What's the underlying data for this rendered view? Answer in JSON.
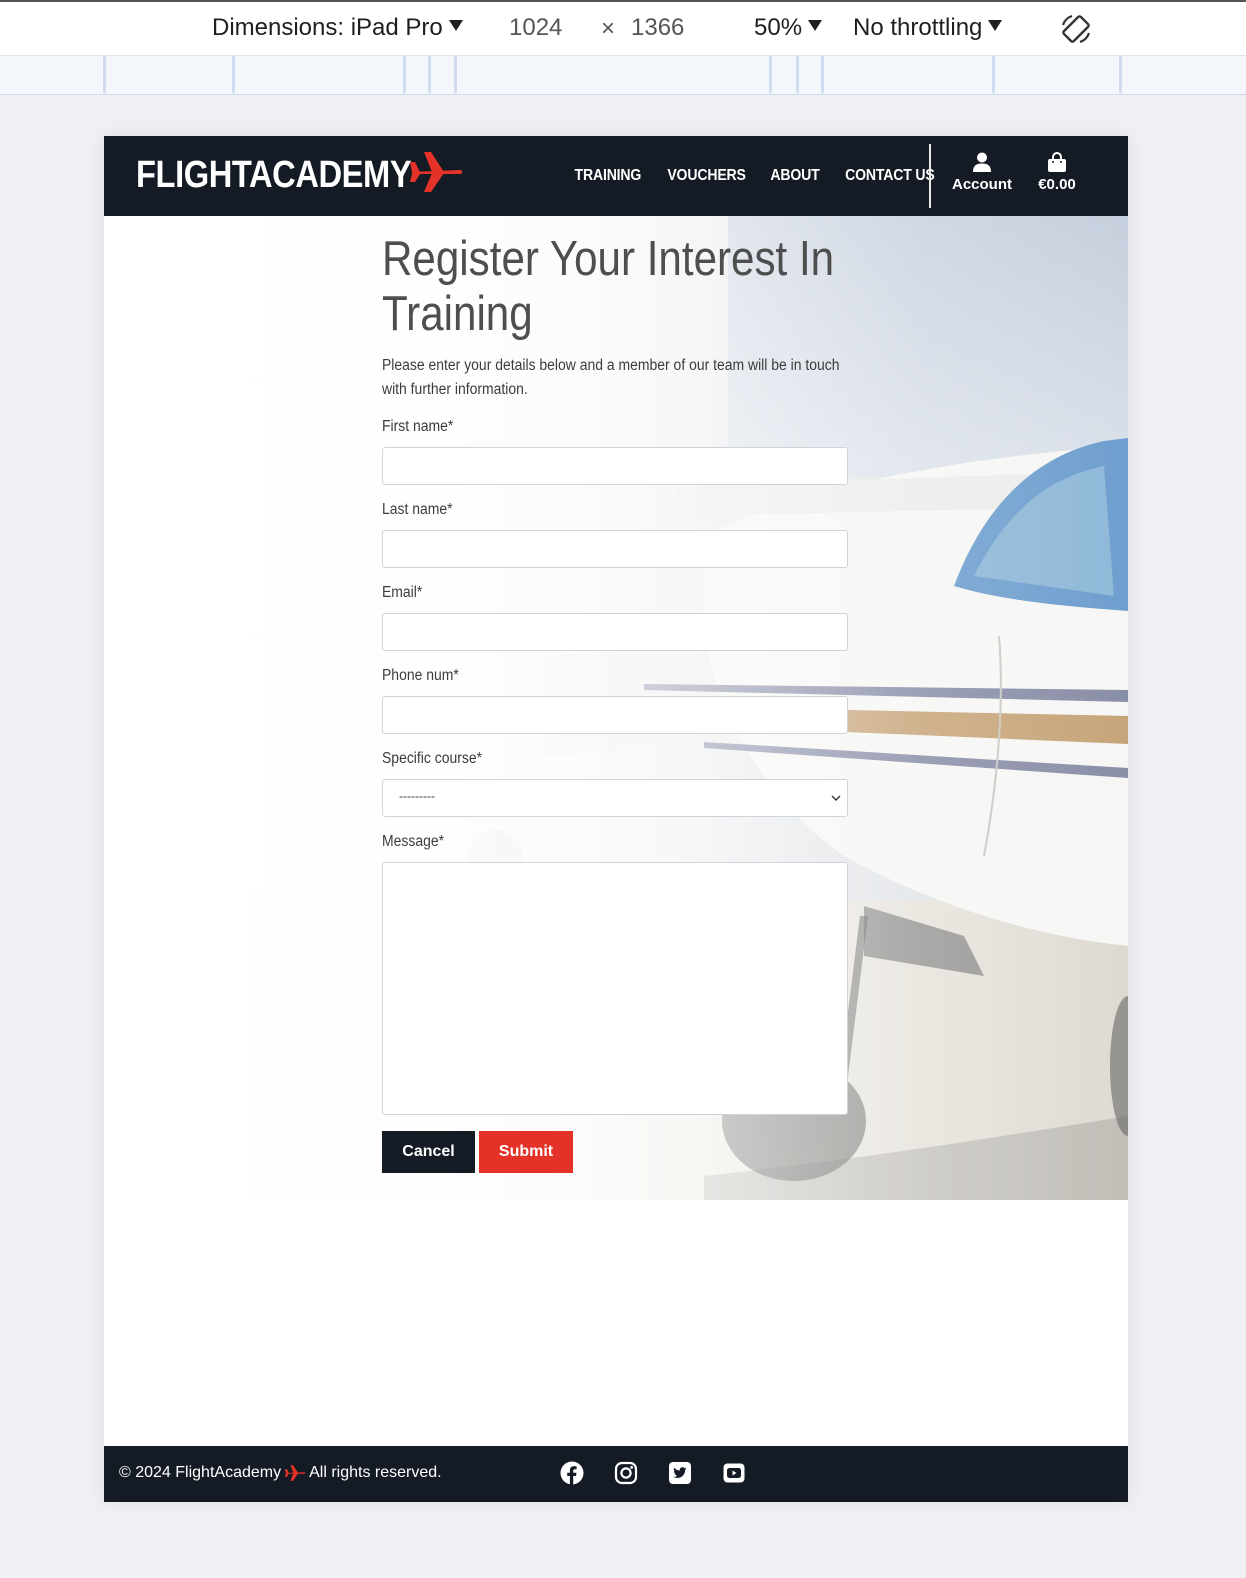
{
  "devtools": {
    "dimensions_label": "Dimensions: iPad Pro",
    "width": "1024",
    "times": "×",
    "height": "1366",
    "zoom": "50%",
    "throttling": "No throttling",
    "rotate_icon": "rotate-icon"
  },
  "navbar": {
    "logo_text": "FLIGHTACADEMY",
    "logo_icon": "plane-icon",
    "links": [
      "TRAINING",
      "VOUCHERS",
      "ABOUT",
      "CONTACT US"
    ],
    "account_label": "Account",
    "account_icon": "user-icon",
    "cart_label": "€0.00",
    "cart_icon": "shopping-bag-icon"
  },
  "form": {
    "title": "Register Your Interest In Training",
    "intro": "Please enter your details below and a member of our team will be in touch with further information.",
    "first_name_label": "First name*",
    "last_name_label": "Last name*",
    "email_label": "Email*",
    "phone_label": "Phone num*",
    "course_label": "Specific course*",
    "course_selected": "---------",
    "message_label": "Message*",
    "cancel_label": "Cancel",
    "submit_label": "Submit"
  },
  "footer": {
    "copyright_prefix": "© 2024 FlightAcademy",
    "copyright_suffix": "All rights reserved.",
    "social_icons": [
      "facebook-icon",
      "instagram-icon",
      "twitter-icon",
      "youtube-icon"
    ]
  },
  "colors": {
    "navbar_bg": "#151b24",
    "accent_red": "#e53228",
    "title_text": "#4e4e4e"
  }
}
